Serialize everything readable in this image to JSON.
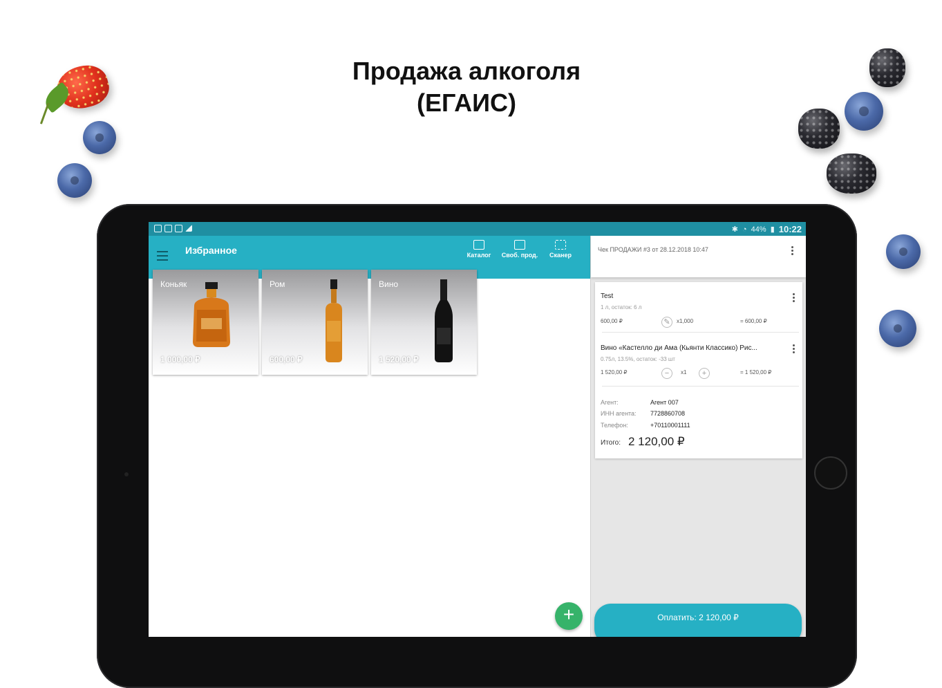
{
  "headline": {
    "line1": "Продажа алкоголя",
    "line2": "(ЕГАИС)"
  },
  "statusbar": {
    "time": "10:22",
    "battery": "44%"
  },
  "appbar": {
    "title": "Избранное",
    "actions": [
      {
        "label": "Каталог",
        "icon": "catalog-icon"
      },
      {
        "label": "Своб. прод.",
        "icon": "edit-icon"
      },
      {
        "label": "Сканер",
        "icon": "scanner-icon"
      }
    ]
  },
  "products": [
    {
      "name": "Коньяк",
      "price": "1 000,00 ₽",
      "icon": "cognac-bottle-icon"
    },
    {
      "name": "Ром",
      "price": "600,00 ₽",
      "icon": "rum-bottle-icon"
    },
    {
      "name": "Вино",
      "price": "1 520,00 ₽",
      "icon": "wine-bottle-icon"
    }
  ],
  "receipt": {
    "title": "Чек ПРОДАЖИ #3 от 28.12.2018 10:47",
    "items": [
      {
        "name": "Test",
        "sub": "1 л, остаток: 6 л",
        "price": "600,00 ₽",
        "qty": "х1,000",
        "total": "= 600,00 ₽"
      },
      {
        "name": "Вино «Кастелло ди Ама (Кьянти Классико) Рис...",
        "sub": "0.75л, 13.5%, остаток: -33 шт",
        "price": "1 520,00 ₽",
        "qty": "х1",
        "total": "= 1 520,00 ₽"
      }
    ],
    "agent": {
      "label": "Агент:",
      "value": "Агент 007"
    },
    "inn": {
      "label": "ИНН агента:",
      "value": "7728860708"
    },
    "phone": {
      "label": "Телефон:",
      "value": "+70110001111"
    },
    "total_label": "Итого:",
    "total_value": "2 120,00 ₽",
    "pay_label": "Оплатить: 2 120,00 ₽"
  },
  "colors": {
    "primary": "#26b0c4",
    "status": "#1f8fa2",
    "fab": "#36b36a"
  }
}
